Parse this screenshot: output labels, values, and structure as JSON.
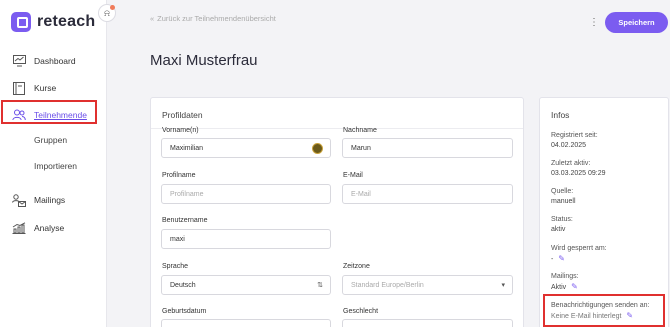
{
  "app": {
    "name": "reteach"
  },
  "sidebar": {
    "items": [
      {
        "label": "Dashboard",
        "icon": "dashboard-icon"
      },
      {
        "label": "Kurse",
        "icon": "book-icon"
      },
      {
        "label": "Teilnehmende",
        "icon": "users-icon",
        "active": true
      },
      {
        "label": "Gruppen"
      },
      {
        "label": "Importieren"
      },
      {
        "label": "Mailings",
        "icon": "mailings-icon"
      },
      {
        "label": "Analyse",
        "icon": "analytics-icon"
      }
    ]
  },
  "topbar": {
    "back_label": "Zurück zur Teilnehmendenübersicht",
    "save_label": "Speichern",
    "more_label": "⋮"
  },
  "page": {
    "title": "Maxi Musterfrau"
  },
  "profile": {
    "section_title": "Profildaten",
    "fields": {
      "firstname": {
        "label": "Vorname(n)",
        "value": "Maximilian"
      },
      "lastname": {
        "label": "Nachname",
        "value": "Marun"
      },
      "profilename": {
        "label": "Profilname",
        "placeholder": "Profilname"
      },
      "email": {
        "label": "E-Mail",
        "placeholder": "E-Mail"
      },
      "username": {
        "label": "Benutzername",
        "value": "maxi"
      },
      "language": {
        "label": "Sprache",
        "value": "Deutsch"
      },
      "timezone": {
        "label": "Zeitzone",
        "placeholder": "Standard Europe/Berlin"
      },
      "birthdate": {
        "label": "Geburtsdatum"
      },
      "gender": {
        "label": "Geschlecht"
      }
    }
  },
  "info": {
    "title": "Infos",
    "registered": {
      "label": "Registriert seit:",
      "value": "04.02.2025"
    },
    "last_active": {
      "label": "Zuletzt aktiv:",
      "value": "03.03.2025 09:29"
    },
    "source": {
      "label": "Quelle:",
      "value": "manuell"
    },
    "status": {
      "label": "Status:",
      "value": "aktiv"
    },
    "locked": {
      "label": "Wird gesperrt am:",
      "value": "-"
    },
    "mailings": {
      "label": "Mailings:",
      "value": "Aktiv"
    },
    "notifications": {
      "label": "Benachrichtigungen senden an:",
      "value": "Keine E-Mail hinterlegt"
    }
  },
  "colors": {
    "accent": "#7b5cf0",
    "highlight": "#e0302f"
  }
}
